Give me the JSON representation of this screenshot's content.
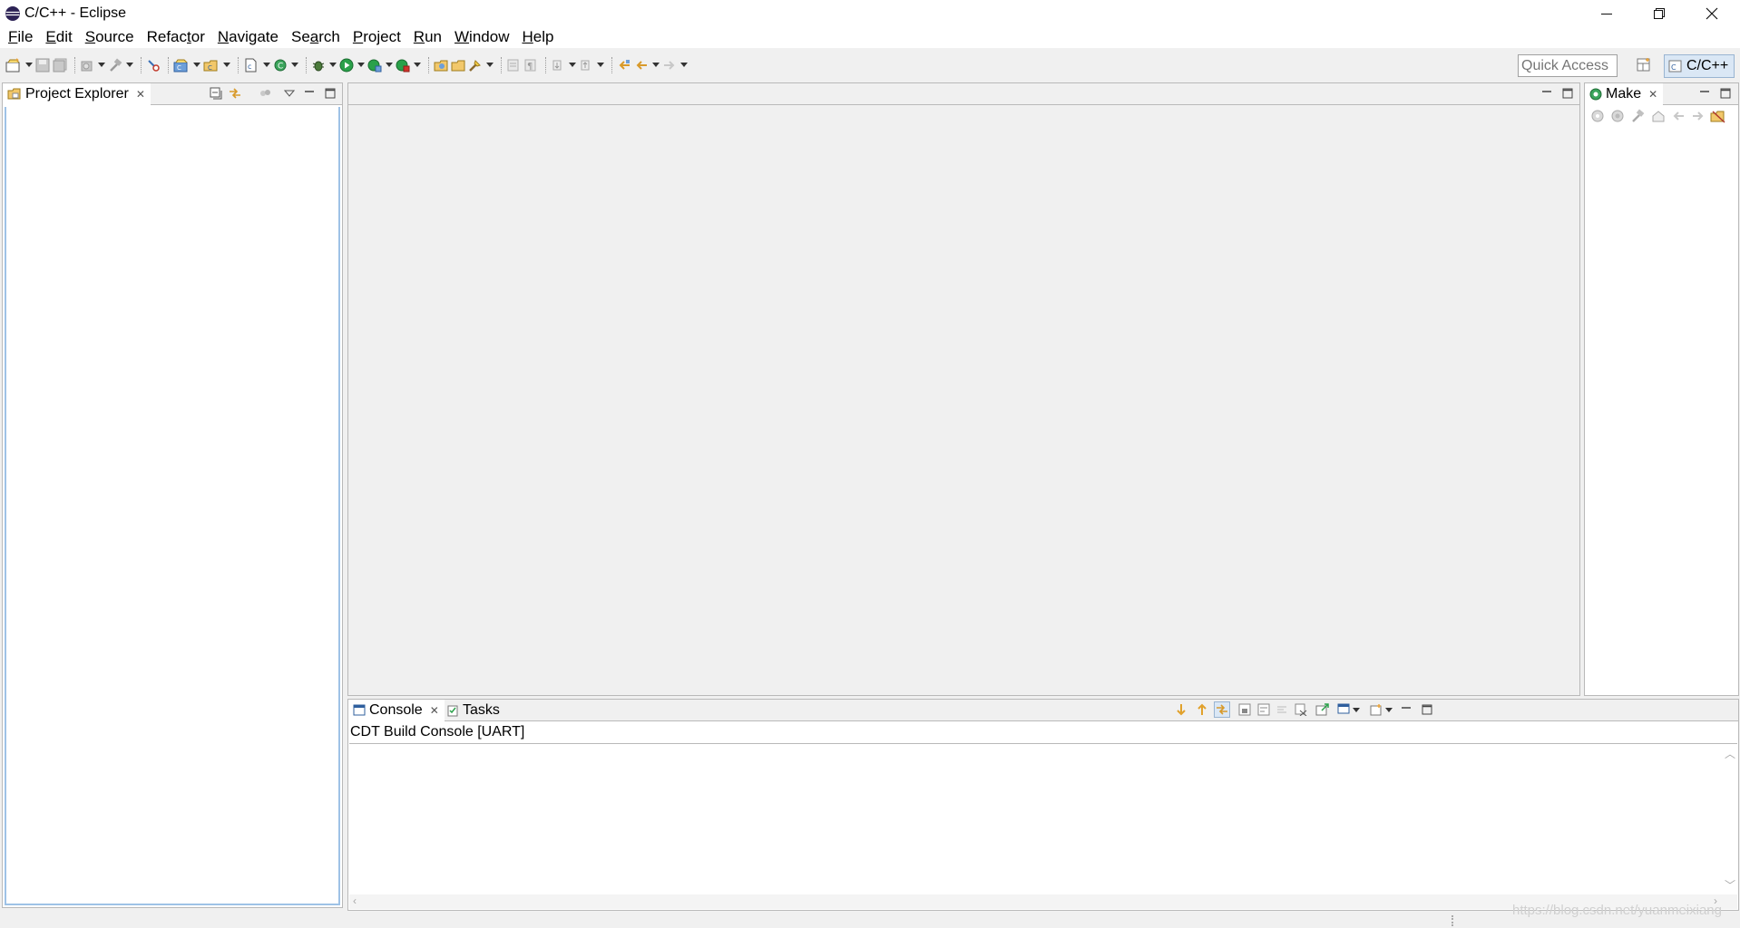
{
  "window": {
    "title": "C/C++ - Eclipse"
  },
  "menu": [
    {
      "label": "File",
      "mnemonic": "F",
      "rest": "ile"
    },
    {
      "label": "Edit",
      "mnemonic": "E",
      "rest": "dit"
    },
    {
      "label": "Source",
      "mnemonic": "S",
      "rest": "ource"
    },
    {
      "label": "Refactor",
      "mnemonic": "",
      "rest": "Refac",
      "mnemonic2": "t",
      "rest2": "or"
    },
    {
      "label": "Navigate",
      "mnemonic": "N",
      "rest": "avigate"
    },
    {
      "label": "Search",
      "mnemonic": "",
      "rest": "Se",
      "mnemonic2": "a",
      "rest2": "rch"
    },
    {
      "label": "Project",
      "mnemonic": "P",
      "rest": "roject"
    },
    {
      "label": "Run",
      "mnemonic": "R",
      "rest": "un"
    },
    {
      "label": "Window",
      "mnemonic": "W",
      "rest": "indow"
    },
    {
      "label": "Help",
      "mnemonic": "H",
      "rest": "elp"
    }
  ],
  "toolbar": {
    "quick_access_placeholder": "Quick Access",
    "perspective_label": "C/C++"
  },
  "project_explorer": {
    "tab_label": "Project Explorer"
  },
  "make": {
    "tab_label": "Make"
  },
  "console": {
    "tab_label": "Console",
    "tasks_tab_label": "Tasks",
    "console_name": "CDT Build Console [UART]"
  },
  "watermark": "https://blog.csdn.net/yuanmeixiang"
}
